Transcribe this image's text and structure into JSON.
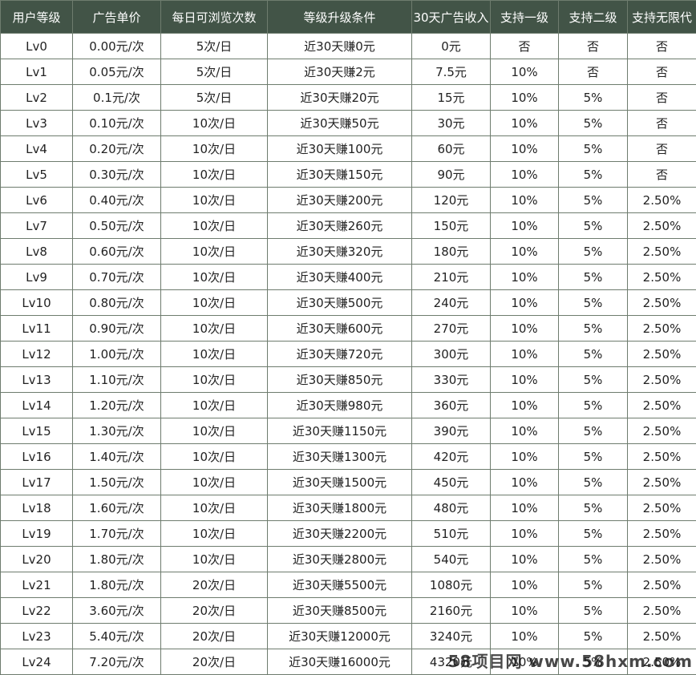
{
  "table": {
    "headers": [
      "用户等级",
      "广告单价",
      "每日可浏览次数",
      "等级升级条件",
      "30天广告收入",
      "支持一级",
      "支持二级",
      "支持无限代"
    ],
    "rows": [
      [
        "Lv0",
        "0.00元/次",
        "5次/日",
        "近30天赚0元",
        "0元",
        "否",
        "否",
        "否"
      ],
      [
        "Lv1",
        "0.05元/次",
        "5次/日",
        "近30天赚2元",
        "7.5元",
        "10%",
        "否",
        "否"
      ],
      [
        "Lv2",
        "0.1元/次",
        "5次/日",
        "近30天赚20元",
        "15元",
        "10%",
        "5%",
        "否"
      ],
      [
        "Lv3",
        "0.10元/次",
        "10次/日",
        "近30天赚50元",
        "30元",
        "10%",
        "5%",
        "否"
      ],
      [
        "Lv4",
        "0.20元/次",
        "10次/日",
        "近30天赚100元",
        "60元",
        "10%",
        "5%",
        "否"
      ],
      [
        "Lv5",
        "0.30元/次",
        "10次/日",
        "近30天赚150元",
        "90元",
        "10%",
        "5%",
        "否"
      ],
      [
        "Lv6",
        "0.40元/次",
        "10次/日",
        "近30天赚200元",
        "120元",
        "10%",
        "5%",
        "2.50%"
      ],
      [
        "Lv7",
        "0.50元/次",
        "10次/日",
        "近30天赚260元",
        "150元",
        "10%",
        "5%",
        "2.50%"
      ],
      [
        "Lv8",
        "0.60元/次",
        "10次/日",
        "近30天赚320元",
        "180元",
        "10%",
        "5%",
        "2.50%"
      ],
      [
        "Lv9",
        "0.70元/次",
        "10次/日",
        "近30天赚400元",
        "210元",
        "10%",
        "5%",
        "2.50%"
      ],
      [
        "Lv10",
        "0.80元/次",
        "10次/日",
        "近30天赚500元",
        "240元",
        "10%",
        "5%",
        "2.50%"
      ],
      [
        "Lv11",
        "0.90元/次",
        "10次/日",
        "近30天赚600元",
        "270元",
        "10%",
        "5%",
        "2.50%"
      ],
      [
        "Lv12",
        "1.00元/次",
        "10次/日",
        "近30天赚720元",
        "300元",
        "10%",
        "5%",
        "2.50%"
      ],
      [
        "Lv13",
        "1.10元/次",
        "10次/日",
        "近30天赚850元",
        "330元",
        "10%",
        "5%",
        "2.50%"
      ],
      [
        "Lv14",
        "1.20元/次",
        "10次/日",
        "近30天赚980元",
        "360元",
        "10%",
        "5%",
        "2.50%"
      ],
      [
        "Lv15",
        "1.30元/次",
        "10次/日",
        "近30天赚1150元",
        "390元",
        "10%",
        "5%",
        "2.50%"
      ],
      [
        "Lv16",
        "1.40元/次",
        "10次/日",
        "近30天赚1300元",
        "420元",
        "10%",
        "5%",
        "2.50%"
      ],
      [
        "Lv17",
        "1.50元/次",
        "10次/日",
        "近30天赚1500元",
        "450元",
        "10%",
        "5%",
        "2.50%"
      ],
      [
        "Lv18",
        "1.60元/次",
        "10次/日",
        "近30天赚1800元",
        "480元",
        "10%",
        "5%",
        "2.50%"
      ],
      [
        "Lv19",
        "1.70元/次",
        "10次/日",
        "近30天赚2200元",
        "510元",
        "10%",
        "5%",
        "2.50%"
      ],
      [
        "Lv20",
        "1.80元/次",
        "10次/日",
        "近30天赚2800元",
        "540元",
        "10%",
        "5%",
        "2.50%"
      ],
      [
        "Lv21",
        "1.80元/次",
        "20次/日",
        "近30天赚5500元",
        "1080元",
        "10%",
        "5%",
        "2.50%"
      ],
      [
        "Lv22",
        "3.60元/次",
        "20次/日",
        "近30天赚8500元",
        "2160元",
        "10%",
        "5%",
        "2.50%"
      ],
      [
        "Lv23",
        "5.40元/次",
        "20次/日",
        "近30天赚12000元",
        "3240元",
        "10%",
        "5%",
        "2.50%"
      ],
      [
        "Lv24",
        "7.20元/次",
        "20次/日",
        "近30天赚16000元",
        "4320元",
        "10%",
        "5%",
        "2.50%"
      ]
    ]
  },
  "watermark": "58项目网 www.58hxm.com",
  "colors": {
    "header_bg": "#425447",
    "header_text": "#ffffff",
    "grid": "#6e7c6e"
  }
}
